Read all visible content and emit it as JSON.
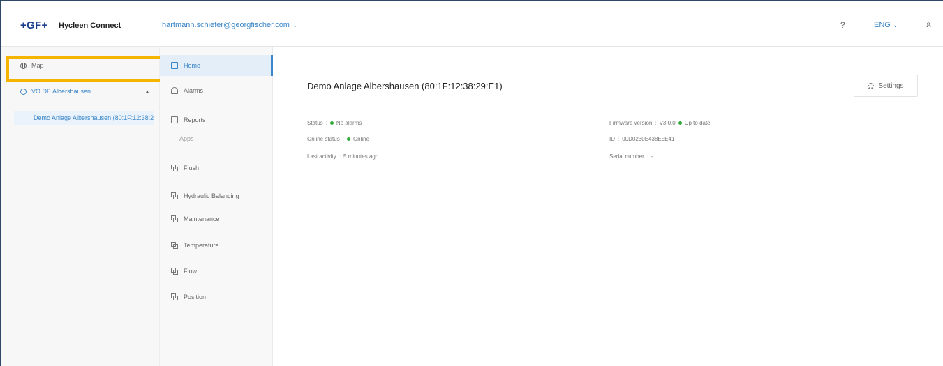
{
  "header": {
    "logo": "+GF+",
    "app_name": "Hycleen Connect",
    "account": "hartmann.schiefer@georgfischer.com",
    "help": "?",
    "language": "ENG",
    "user_icon": "user-icon",
    "chevron_icon": "chevron-down-icon"
  },
  "sidebar": {
    "map_label": "Map",
    "site_label": "VO DE Albershausen",
    "device_label": "Demo Anlage Albershausen (80:1F:12:38:29:E1)",
    "highlight_color": "#f5b400"
  },
  "nav": {
    "items": [
      {
        "label": "Home",
        "icon": "home-icon"
      },
      {
        "label": "Alarms",
        "icon": "bell-icon"
      },
      {
        "label": "Reports",
        "icon": "report-icon"
      }
    ],
    "apps_label": "Apps",
    "apps": [
      {
        "label": "Flush",
        "icon": "app-icon"
      },
      {
        "label": "Hydraulic Balancing",
        "icon": "app-icon"
      },
      {
        "label": "Maintenance",
        "icon": "app-icon"
      },
      {
        "label": "Temperature",
        "icon": "app-icon"
      },
      {
        "label": "Flow",
        "icon": "app-icon"
      },
      {
        "label": "Position",
        "icon": "app-icon"
      }
    ]
  },
  "main": {
    "title": "Demo Anlage Albershausen (80:1F:12:38:29:E1)",
    "settings_label": "Settings",
    "status_label": "Status",
    "status_value": "No alarms",
    "online_label": "Online status",
    "online_value": "Online",
    "activity_label": "Last activity",
    "activity_value": "5 minutes ago",
    "firmware_label": "Firmware version",
    "firmware_value": "V3.0.0",
    "firmware_status": "Up to date",
    "id_label": "ID",
    "id_value": "00D0230E438E5E41",
    "serial_label": "Serial number",
    "serial_value": "-",
    "accent_color": "#3a86c8",
    "ok_color": "#2faa3a"
  }
}
